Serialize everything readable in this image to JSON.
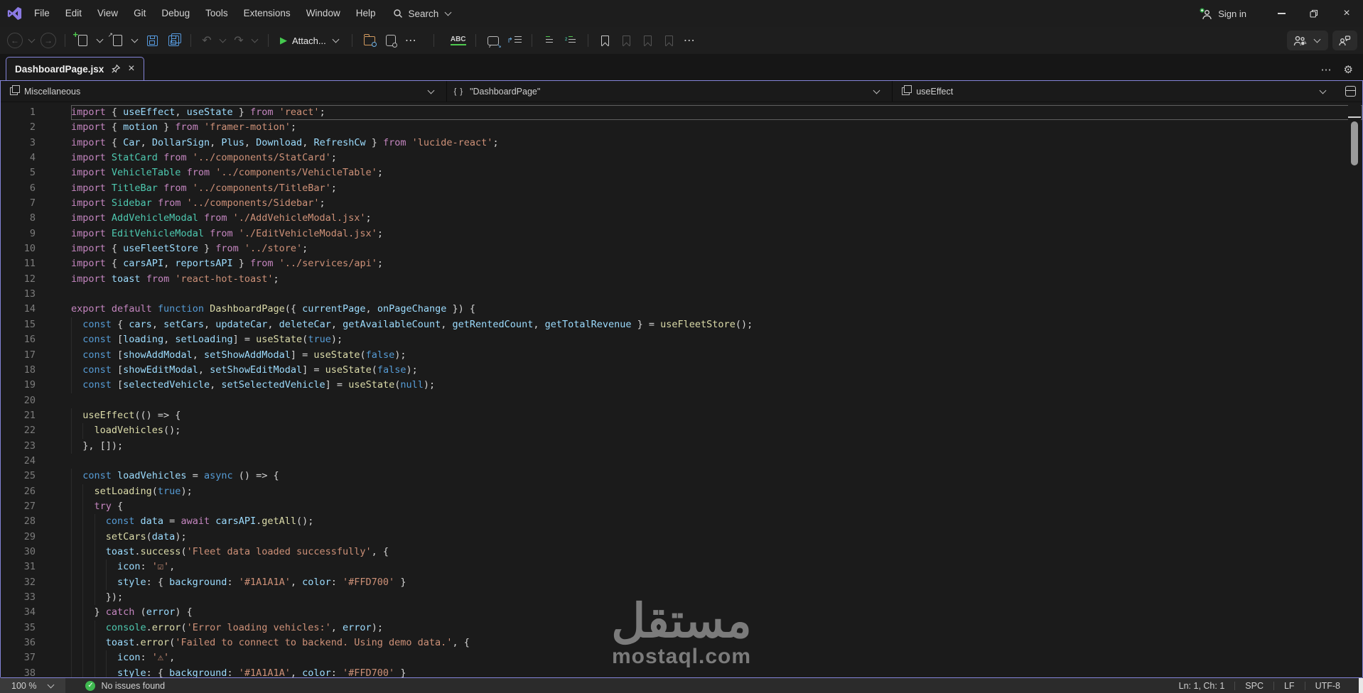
{
  "titlebar": {
    "menus": [
      "File",
      "Edit",
      "View",
      "Git",
      "Debug",
      "Tools",
      "Extensions",
      "Window",
      "Help"
    ],
    "search_label": "Search",
    "sign_in_label": "Sign in"
  },
  "toolbar": {
    "attach_label": "Attach...",
    "spell_label": "ABC"
  },
  "icons": {
    "back": "←",
    "forward": "→",
    "undo": "↶",
    "redo": "↷",
    "play": "▶",
    "more": "⋯",
    "gear": "⚙",
    "close": "×",
    "check": "✓",
    "nav_arrow": "↱",
    "wrap_mark": "²"
  },
  "tab": {
    "title": "DashboardPage.jsx"
  },
  "breadcrumb": {
    "project": "Miscellaneous",
    "module_prefix": "{ }",
    "module": "\"DashboardPage\"",
    "symbol": "useEffect"
  },
  "status_bar": {
    "zoom": "100 %",
    "issues": "No issues found",
    "position": "Ln: 1, Ch: 1",
    "spaces": "SPC",
    "line_ending": "LF",
    "encoding": "UTF-8"
  },
  "watermark": {
    "arabic": "مستقل",
    "domain": "mostaql.com"
  },
  "colors": {
    "accent_border": "#8484d8",
    "logo_purple": "#8B7AE3",
    "run_green": "#45c94f",
    "status_green": "#3fb950",
    "save_blue": "#569ade",
    "folder_orange": "#d19a5f",
    "tokens": {
      "k": "#C586C0",
      "b": "#569CD6",
      "v": "#9CDCFE",
      "t": "#4EC9B0",
      "f": "#DCDCAA",
      "s": "#CE9178",
      "p": "#D4D4D4",
      "w": "#D4D4D4"
    }
  },
  "editor": {
    "current_line": 1,
    "lines": [
      {
        "n": 1,
        "t": [
          [
            "k",
            "import "
          ],
          [
            "p",
            "{ "
          ],
          [
            "v",
            "useEffect"
          ],
          [
            "p",
            ", "
          ],
          [
            "v",
            "useState"
          ],
          [
            "p",
            " } "
          ],
          [
            "k",
            "from "
          ],
          [
            "s",
            "'react'"
          ],
          [
            "p",
            ";"
          ]
        ]
      },
      {
        "n": 2,
        "t": [
          [
            "k",
            "import "
          ],
          [
            "p",
            "{ "
          ],
          [
            "v",
            "motion"
          ],
          [
            "p",
            " } "
          ],
          [
            "k",
            "from "
          ],
          [
            "s",
            "'framer-motion'"
          ],
          [
            "p",
            ";"
          ]
        ]
      },
      {
        "n": 3,
        "t": [
          [
            "k",
            "import "
          ],
          [
            "p",
            "{ "
          ],
          [
            "v",
            "Car"
          ],
          [
            "p",
            ", "
          ],
          [
            "v",
            "DollarSign"
          ],
          [
            "p",
            ", "
          ],
          [
            "v",
            "Plus"
          ],
          [
            "p",
            ", "
          ],
          [
            "v",
            "Download"
          ],
          [
            "p",
            ", "
          ],
          [
            "v",
            "RefreshCw"
          ],
          [
            "p",
            " } "
          ],
          [
            "k",
            "from "
          ],
          [
            "s",
            "'lucide-react'"
          ],
          [
            "p",
            ";"
          ]
        ]
      },
      {
        "n": 4,
        "t": [
          [
            "k",
            "import "
          ],
          [
            "t",
            "StatCard"
          ],
          [
            "w",
            " "
          ],
          [
            "k",
            "from "
          ],
          [
            "s",
            "'../components/StatCard'"
          ],
          [
            "p",
            ";"
          ]
        ]
      },
      {
        "n": 5,
        "t": [
          [
            "k",
            "import "
          ],
          [
            "t",
            "VehicleTable"
          ],
          [
            "w",
            " "
          ],
          [
            "k",
            "from "
          ],
          [
            "s",
            "'../components/VehicleTable'"
          ],
          [
            "p",
            ";"
          ]
        ]
      },
      {
        "n": 6,
        "t": [
          [
            "k",
            "import "
          ],
          [
            "t",
            "TitleBar"
          ],
          [
            "w",
            " "
          ],
          [
            "k",
            "from "
          ],
          [
            "s",
            "'../components/TitleBar'"
          ],
          [
            "p",
            ";"
          ]
        ]
      },
      {
        "n": 7,
        "t": [
          [
            "k",
            "import "
          ],
          [
            "t",
            "Sidebar"
          ],
          [
            "w",
            " "
          ],
          [
            "k",
            "from "
          ],
          [
            "s",
            "'../components/Sidebar'"
          ],
          [
            "p",
            ";"
          ]
        ]
      },
      {
        "n": 8,
        "t": [
          [
            "k",
            "import "
          ],
          [
            "t",
            "AddVehicleModal"
          ],
          [
            "w",
            " "
          ],
          [
            "k",
            "from "
          ],
          [
            "s",
            "'./AddVehicleModal.jsx'"
          ],
          [
            "p",
            ";"
          ]
        ]
      },
      {
        "n": 9,
        "t": [
          [
            "k",
            "import "
          ],
          [
            "t",
            "EditVehicleModal"
          ],
          [
            "w",
            " "
          ],
          [
            "k",
            "from "
          ],
          [
            "s",
            "'./EditVehicleModal.jsx'"
          ],
          [
            "p",
            ";"
          ]
        ]
      },
      {
        "n": 10,
        "t": [
          [
            "k",
            "import "
          ],
          [
            "p",
            "{ "
          ],
          [
            "v",
            "useFleetStore"
          ],
          [
            "p",
            " } "
          ],
          [
            "k",
            "from "
          ],
          [
            "s",
            "'../store'"
          ],
          [
            "p",
            ";"
          ]
        ]
      },
      {
        "n": 11,
        "t": [
          [
            "k",
            "import "
          ],
          [
            "p",
            "{ "
          ],
          [
            "v",
            "carsAPI"
          ],
          [
            "p",
            ", "
          ],
          [
            "v",
            "reportsAPI"
          ],
          [
            "p",
            " } "
          ],
          [
            "k",
            "from "
          ],
          [
            "s",
            "'../services/api'"
          ],
          [
            "p",
            ";"
          ]
        ]
      },
      {
        "n": 12,
        "t": [
          [
            "k",
            "import "
          ],
          [
            "v",
            "toast"
          ],
          [
            "w",
            " "
          ],
          [
            "k",
            "from "
          ],
          [
            "s",
            "'react-hot-toast'"
          ],
          [
            "p",
            ";"
          ]
        ]
      },
      {
        "n": 13,
        "t": []
      },
      {
        "n": 14,
        "t": [
          [
            "k",
            "export default "
          ],
          [
            "b",
            "function "
          ],
          [
            "f",
            "DashboardPage"
          ],
          [
            "p",
            "({ "
          ],
          [
            "v",
            "currentPage"
          ],
          [
            "p",
            ", "
          ],
          [
            "v",
            "onPageChange"
          ],
          [
            "p",
            " }) {"
          ]
        ]
      },
      {
        "n": 15,
        "t": [
          [
            "w",
            "  "
          ],
          [
            "b",
            "const "
          ],
          [
            "p",
            "{ "
          ],
          [
            "v",
            "cars"
          ],
          [
            "p",
            ", "
          ],
          [
            "v",
            "setCars"
          ],
          [
            "p",
            ", "
          ],
          [
            "v",
            "updateCar"
          ],
          [
            "p",
            ", "
          ],
          [
            "v",
            "deleteCar"
          ],
          [
            "p",
            ", "
          ],
          [
            "v",
            "getAvailableCount"
          ],
          [
            "p",
            ", "
          ],
          [
            "v",
            "getRentedCount"
          ],
          [
            "p",
            ", "
          ],
          [
            "v",
            "getTotalRevenue"
          ],
          [
            "p",
            " } = "
          ],
          [
            "f",
            "useFleetStore"
          ],
          [
            "p",
            "();"
          ]
        ]
      },
      {
        "n": 16,
        "t": [
          [
            "w",
            "  "
          ],
          [
            "b",
            "const "
          ],
          [
            "p",
            "["
          ],
          [
            "v",
            "loading"
          ],
          [
            "p",
            ", "
          ],
          [
            "v",
            "setLoading"
          ],
          [
            "p",
            "] = "
          ],
          [
            "f",
            "useState"
          ],
          [
            "p",
            "("
          ],
          [
            "b",
            "true"
          ],
          [
            "p",
            ");"
          ]
        ]
      },
      {
        "n": 17,
        "t": [
          [
            "w",
            "  "
          ],
          [
            "b",
            "const "
          ],
          [
            "p",
            "["
          ],
          [
            "v",
            "showAddModal"
          ],
          [
            "p",
            ", "
          ],
          [
            "v",
            "setShowAddModal"
          ],
          [
            "p",
            "] = "
          ],
          [
            "f",
            "useState"
          ],
          [
            "p",
            "("
          ],
          [
            "b",
            "false"
          ],
          [
            "p",
            ");"
          ]
        ]
      },
      {
        "n": 18,
        "t": [
          [
            "w",
            "  "
          ],
          [
            "b",
            "const "
          ],
          [
            "p",
            "["
          ],
          [
            "v",
            "showEditModal"
          ],
          [
            "p",
            ", "
          ],
          [
            "v",
            "setShowEditModal"
          ],
          [
            "p",
            "] = "
          ],
          [
            "f",
            "useState"
          ],
          [
            "p",
            "("
          ],
          [
            "b",
            "false"
          ],
          [
            "p",
            ");"
          ]
        ]
      },
      {
        "n": 19,
        "t": [
          [
            "w",
            "  "
          ],
          [
            "b",
            "const "
          ],
          [
            "p",
            "["
          ],
          [
            "v",
            "selectedVehicle"
          ],
          [
            "p",
            ", "
          ],
          [
            "v",
            "setSelectedVehicle"
          ],
          [
            "p",
            "] = "
          ],
          [
            "f",
            "useState"
          ],
          [
            "p",
            "("
          ],
          [
            "b",
            "null"
          ],
          [
            "p",
            ");"
          ]
        ]
      },
      {
        "n": 20,
        "t": []
      },
      {
        "n": 21,
        "t": [
          [
            "w",
            "  "
          ],
          [
            "f",
            "useEffect"
          ],
          [
            "p",
            "(() => {"
          ]
        ]
      },
      {
        "n": 22,
        "t": [
          [
            "w",
            "    "
          ],
          [
            "f",
            "loadVehicles"
          ],
          [
            "p",
            "();"
          ]
        ]
      },
      {
        "n": 23,
        "t": [
          [
            "w",
            "  "
          ],
          [
            "p",
            "}, []);"
          ]
        ]
      },
      {
        "n": 24,
        "t": []
      },
      {
        "n": 25,
        "t": [
          [
            "w",
            "  "
          ],
          [
            "b",
            "const "
          ],
          [
            "v",
            "loadVehicles"
          ],
          [
            "p",
            " = "
          ],
          [
            "b",
            "async "
          ],
          [
            "p",
            "() => {"
          ]
        ]
      },
      {
        "n": 26,
        "t": [
          [
            "w",
            "    "
          ],
          [
            "f",
            "setLoading"
          ],
          [
            "p",
            "("
          ],
          [
            "b",
            "true"
          ],
          [
            "p",
            ");"
          ]
        ]
      },
      {
        "n": 27,
        "t": [
          [
            "w",
            "    "
          ],
          [
            "k",
            "try "
          ],
          [
            "p",
            "{"
          ]
        ]
      },
      {
        "n": 28,
        "t": [
          [
            "w",
            "      "
          ],
          [
            "b",
            "const "
          ],
          [
            "v",
            "data"
          ],
          [
            "p",
            " = "
          ],
          [
            "k",
            "await "
          ],
          [
            "v",
            "carsAPI"
          ],
          [
            "p",
            "."
          ],
          [
            "f",
            "getAll"
          ],
          [
            "p",
            "();"
          ]
        ]
      },
      {
        "n": 29,
        "t": [
          [
            "w",
            "      "
          ],
          [
            "f",
            "setCars"
          ],
          [
            "p",
            "("
          ],
          [
            "v",
            "data"
          ],
          [
            "p",
            ");"
          ]
        ]
      },
      {
        "n": 30,
        "t": [
          [
            "w",
            "      "
          ],
          [
            "v",
            "toast"
          ],
          [
            "p",
            "."
          ],
          [
            "f",
            "success"
          ],
          [
            "p",
            "("
          ],
          [
            "s",
            "'Fleet data loaded successfully'"
          ],
          [
            "p",
            ", {"
          ]
        ]
      },
      {
        "n": 31,
        "t": [
          [
            "w",
            "        "
          ],
          [
            "v",
            "icon"
          ],
          [
            "p",
            ": "
          ],
          [
            "s",
            "'☑'"
          ],
          [
            "p",
            ","
          ]
        ]
      },
      {
        "n": 32,
        "t": [
          [
            "w",
            "        "
          ],
          [
            "v",
            "style"
          ],
          [
            "p",
            ": { "
          ],
          [
            "v",
            "background"
          ],
          [
            "p",
            ": "
          ],
          [
            "s",
            "'#1A1A1A'"
          ],
          [
            "p",
            ", "
          ],
          [
            "v",
            "color"
          ],
          [
            "p",
            ": "
          ],
          [
            "s",
            "'#FFD700'"
          ],
          [
            "p",
            " }"
          ]
        ]
      },
      {
        "n": 33,
        "t": [
          [
            "w",
            "      "
          ],
          [
            "p",
            "});"
          ]
        ]
      },
      {
        "n": 34,
        "t": [
          [
            "w",
            "    "
          ],
          [
            "p",
            "} "
          ],
          [
            "k",
            "catch "
          ],
          [
            "p",
            "("
          ],
          [
            "v",
            "error"
          ],
          [
            "p",
            ") {"
          ]
        ]
      },
      {
        "n": 35,
        "t": [
          [
            "w",
            "      "
          ],
          [
            "t",
            "console"
          ],
          [
            "p",
            "."
          ],
          [
            "f",
            "error"
          ],
          [
            "p",
            "("
          ],
          [
            "s",
            "'Error loading vehicles:'"
          ],
          [
            "p",
            ", "
          ],
          [
            "v",
            "error"
          ],
          [
            "p",
            ");"
          ]
        ]
      },
      {
        "n": 36,
        "t": [
          [
            "w",
            "      "
          ],
          [
            "v",
            "toast"
          ],
          [
            "p",
            "."
          ],
          [
            "f",
            "error"
          ],
          [
            "p",
            "("
          ],
          [
            "s",
            "'Failed to connect to backend. Using demo data.'"
          ],
          [
            "p",
            ", {"
          ]
        ]
      },
      {
        "n": 37,
        "t": [
          [
            "w",
            "        "
          ],
          [
            "v",
            "icon"
          ],
          [
            "p",
            ": "
          ],
          [
            "s",
            "'⚠'"
          ],
          [
            "p",
            ","
          ]
        ]
      },
      {
        "n": 38,
        "t": [
          [
            "w",
            "        "
          ],
          [
            "v",
            "style"
          ],
          [
            "p",
            ": { "
          ],
          [
            "v",
            "background"
          ],
          [
            "p",
            ": "
          ],
          [
            "s",
            "'#1A1A1A'"
          ],
          [
            "p",
            ", "
          ],
          [
            "v",
            "color"
          ],
          [
            "p",
            ": "
          ],
          [
            "s",
            "'#FFD700'"
          ],
          [
            "p",
            " }"
          ]
        ]
      }
    ]
  }
}
